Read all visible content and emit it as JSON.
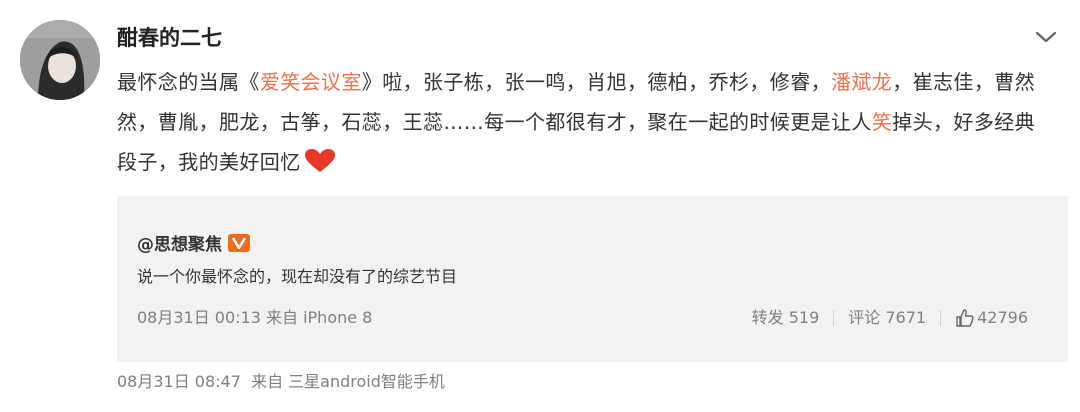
{
  "post": {
    "username": "酣春的二七",
    "text_parts": {
      "p1": "最怀念的当属《",
      "link1": "爱笑会议室",
      "p2": "》啦，张子栋，张一鸣，肖旭，德柏，乔杉，修睿，",
      "link2": "潘斌龙",
      "p3": "，崔志佳，曹然然，曹胤，肥龙，古筝，石蕊，王蕊……每一个都很有才，聚在一起的时候更是让人",
      "link3": "笑",
      "p4": "掉头，好多经典段子，我的美好回忆"
    },
    "heart_icon": "heart-icon",
    "timestamp": "08月31日 08:47",
    "source": "来自 三星android智能手机"
  },
  "quoted": {
    "author": "@思想聚焦",
    "badge": "V",
    "text": "说一个你最怀念的，现在却没有了的综艺节目",
    "meta": "08月31日 00:13 来自 iPhone 8",
    "repost": "转发 519",
    "comment": "评论 7671",
    "likes": "42796"
  },
  "colors": {
    "link": "#eb7350",
    "badge": "#f26b1d",
    "quote_bg": "#f2f2f5",
    "heart": "#e8372b"
  }
}
